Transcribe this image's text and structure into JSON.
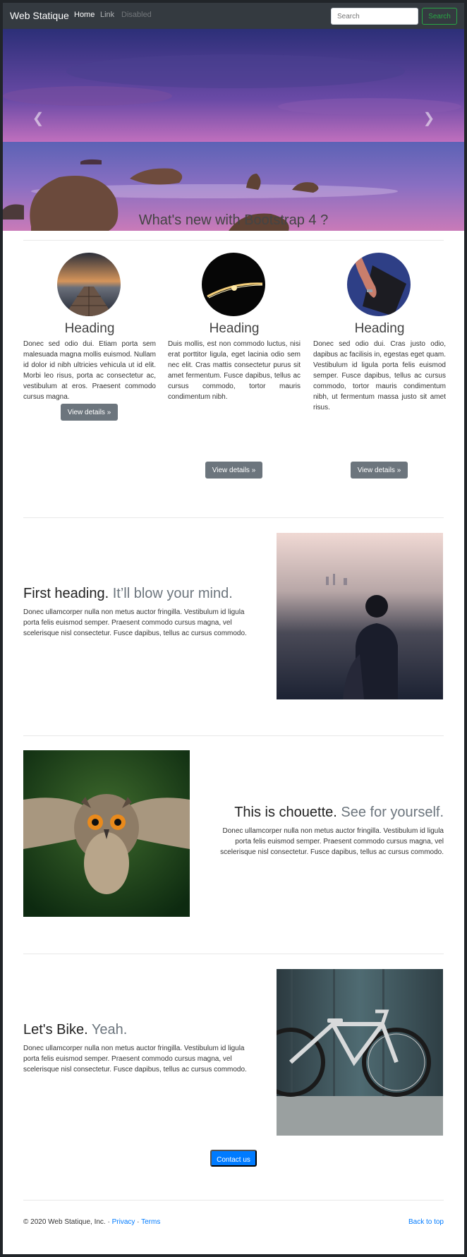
{
  "navbar": {
    "brand": "Web Statique",
    "links": [
      {
        "label": "Home",
        "state": "active"
      },
      {
        "label": "Link",
        "state": "normal"
      },
      {
        "label": "Disabled",
        "state": "disabled"
      }
    ],
    "search_placeholder": "Search",
    "search_button": "Search"
  },
  "carousel": {
    "prev_icon": "chevron-left-icon",
    "next_icon": "chevron-right-icon"
  },
  "section_title": "What's new with Bootstrap 4 ?",
  "columns": [
    {
      "heading": "Heading",
      "text": "Donec sed odio dui. Etiam porta sem malesuada magna mollis euismod. Nullam id dolor id nibh ultricies vehicula ut id elit. Morbi leo risus, porta ac consectetur ac, vestibulum at eros. Praesent commodo cursus magna.",
      "button": "View details »"
    },
    {
      "heading": "Heading",
      "text": "Duis mollis, est non commodo luctus, nisi erat porttitor ligula, eget lacinia odio sem nec elit. Cras mattis consectetur purus sit amet fermentum. Fusce dapibus, tellus ac cursus commodo, tortor mauris condimentum nibh.",
      "button": "View details »"
    },
    {
      "heading": "Heading",
      "text": "Donec sed odio dui. Cras justo odio, dapibus ac facilisis in, egestas eget quam. Vestibulum id ligula porta felis euismod semper. Fusce dapibus, tellus ac cursus commodo, tortor mauris condimentum nibh, ut fermentum massa justo sit amet risus.",
      "button": "View details »"
    }
  ],
  "features": [
    {
      "heading": "First heading.",
      "muted": "It’ll blow your mind.",
      "text": "Donec ullamcorper nulla non metus auctor fringilla. Vestibulum id ligula porta felis euismod semper. Praesent commodo cursus magna, vel scelerisque nisl consectetur. Fusce dapibus, tellus ac cursus commodo."
    },
    {
      "heading": "This is chouette.",
      "muted": "See for yourself.",
      "text": "Donec ullamcorper nulla non metus auctor fringilla. Vestibulum id ligula porta felis euismod semper. Praesent commodo cursus magna, vel scelerisque nisl consectetur. Fusce dapibus, tellus ac cursus commodo."
    },
    {
      "heading": "Let's Bike.",
      "muted": "Yeah.",
      "text": "Donec ullamcorper nulla non metus auctor fringilla. Vestibulum id ligula porta felis euismod semper. Praesent commodo cursus magna, vel scelerisque nisl consectetur. Fusce dapibus, tellus ac cursus commodo."
    }
  ],
  "contact_button": "Contact us",
  "footer": {
    "copyright": "© 2020 Web Statique, Inc. ·",
    "privacy": "Privacy",
    "separator": "·",
    "terms": "Terms",
    "back_to_top": "Back to top"
  },
  "colors": {
    "navbar_bg": "#343a40",
    "success": "#28a745",
    "primary": "#007bff",
    "secondary": "#6c757d"
  }
}
